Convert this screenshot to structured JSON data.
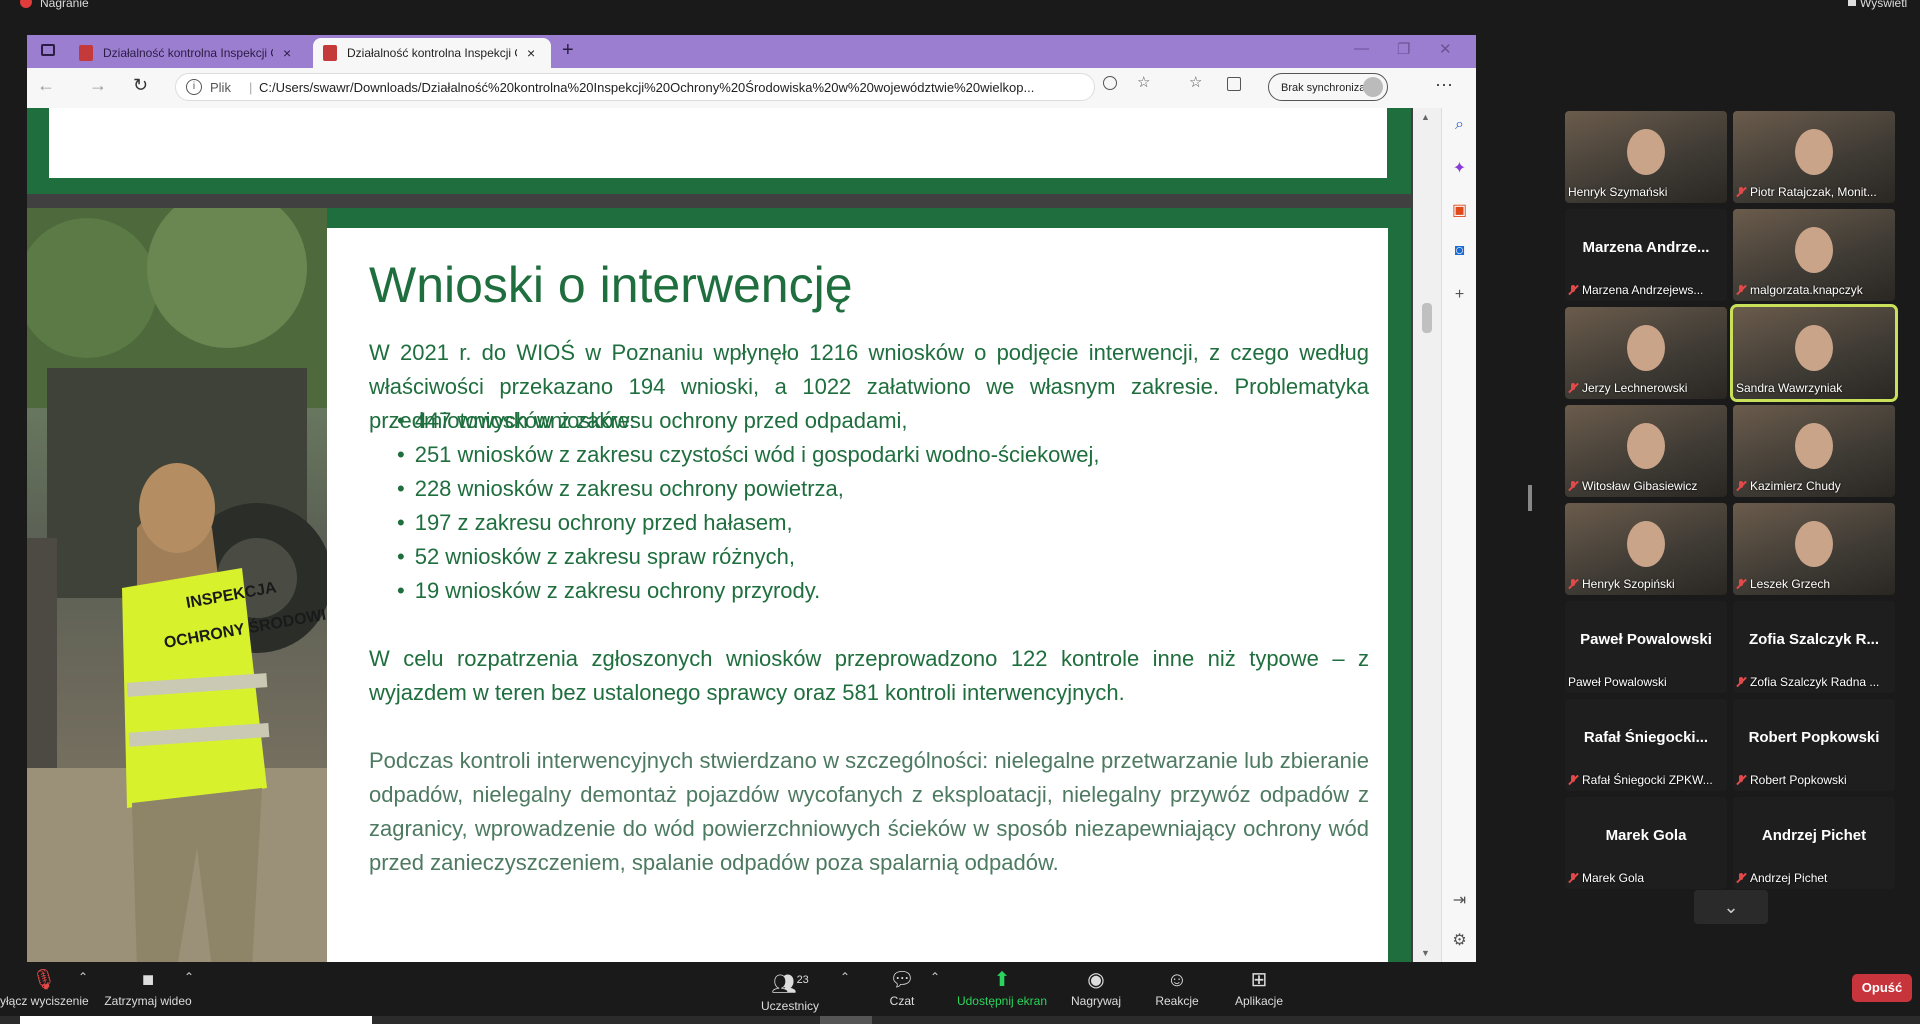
{
  "recording": {
    "label": "Nagranie",
    "view_label": "Wyświetl"
  },
  "browser": {
    "tabs": [
      {
        "title": "Działalność kontrolna Inspekcji O",
        "close": "×"
      },
      {
        "title": "Działalność kontrolna Inspekcji O",
        "close": "×"
      }
    ],
    "new_tab": "+",
    "window_controls": {
      "minimize": "—",
      "maximize": "❐",
      "close": "✕"
    },
    "nav": {
      "back": "←",
      "forward": "→",
      "refresh": "↻"
    },
    "address": {
      "info": "i",
      "scheme_label": "Plik",
      "url": "C:/Users/swawr/Downloads/Działalność%20kontrolna%20Inspekcji%20Ochrony%20Środowiska%20w%20województwie%20wielkop..."
    },
    "sync_label": "Brak synchronizacji",
    "menu": "···"
  },
  "slide": {
    "title": "Wnioski o interwencję",
    "intro": "W 2021 r. do WIOŚ w Poznaniu wpłynęło 1216 wniosków o podjęcie interwencji, z czego według właściwości przekazano 194 wnioski, a 1022 załatwiono we własnym zakresie. Problematyka przedmiotowych wniosków:",
    "bullets": [
      "447 wniosków z zakresu ochrony przed odpadami,",
      "251 wniosków z zakresu czystości wód i gospodarki wodno-ściekowej,",
      "228 wniosków z zakresu ochrony powietrza,",
      "197 z zakresu ochrony przed hałasem,",
      "52 wniosków z zakresu spraw różnych,",
      "19 wniosków z zakresu ochrony przyrody."
    ],
    "para2": "W celu rozpatrzenia zgłoszonych wniosków przeprowadzono 122 kontrole inne niż typowe – z wyjazdem w teren bez ustalonego sprawcy oraz 581 kontroli interwencyjnych.",
    "para3": "Podczas kontroli interwencyjnych stwierdzano w szczególności: nielegalne przetwarzanie lub zbieranie odpadów, nielegalny demontaż pojazdów wycofanych z eksploatacji, nielegalny przywóz odpadów z zagranicy, wprowadzenie do wód powierzchniowych ścieków w sposób niezapewniający ochrony wód przed zanieczyszczeniem, spalanie odpadów poza spalarnią odpadów.",
    "vest_text": "INSPEKCJA OCHRONY ŚRODOWI"
  },
  "participants": [
    {
      "name": "Henryk Szymański",
      "video": true,
      "muted": false
    },
    {
      "name": "Piotr Ratajczak, Monit...",
      "video": true,
      "muted": true
    },
    {
      "name": "Marzena Andrzejews...",
      "big": "Marzena  Andrze...",
      "video": false,
      "muted": true
    },
    {
      "name": "malgorzata.knapczyk",
      "video": true,
      "muted": true
    },
    {
      "name": "Jerzy Lechnerowski",
      "video": true,
      "muted": true
    },
    {
      "name": "Sandra Wawrzyniak",
      "video": true,
      "muted": false,
      "active": true
    },
    {
      "name": "Witosław Gibasiewicz",
      "video": true,
      "muted": true
    },
    {
      "name": "Kazimierz Chudy",
      "video": true,
      "muted": true
    },
    {
      "name": "Henryk Szopiński",
      "video": true,
      "muted": true
    },
    {
      "name": "Leszek Grzech",
      "video": true,
      "muted": true
    },
    {
      "name": "Paweł Powalowski",
      "big": "Paweł Powalowski",
      "video": false,
      "muted": false
    },
    {
      "name": "Zofia Szalczyk Radna ...",
      "big": "Zofia  Szalczyk  R...",
      "video": false,
      "muted": true
    },
    {
      "name": "Rafał Śniegocki ZPKW...",
      "big": "Rafał  Śniegocki...",
      "video": false,
      "muted": true
    },
    {
      "name": "Robert Popkowski",
      "big": "Robert Popkowski",
      "video": false,
      "muted": true
    },
    {
      "name": "Marek Gola",
      "big": "Marek Gola",
      "video": false,
      "muted": true
    },
    {
      "name": "Andrzej Pichet",
      "big": "Andrzej Pichet",
      "video": false,
      "muted": true
    }
  ],
  "toolbar": {
    "mute": "yłącz wyciszenie",
    "video": "Zatrzymaj wideo",
    "participants": "Uczestnicy",
    "participants_count": "23",
    "chat": "Czat",
    "share": "Udostępnij ekran",
    "record": "Nagrywaj",
    "reactions": "Reakcje",
    "apps": "Aplikacje",
    "leave": "Opuść",
    "share_color": "#2bd45d",
    "leave_color": "#c8343b"
  }
}
